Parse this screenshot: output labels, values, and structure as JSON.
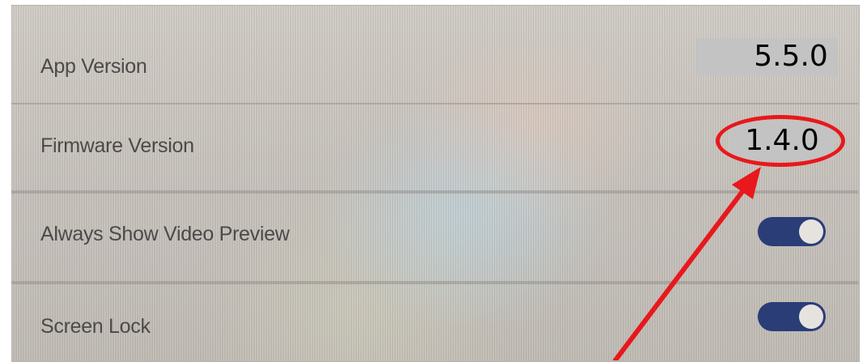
{
  "settings": {
    "app_version": {
      "label": "App Version",
      "value": "5.5.0"
    },
    "firmware_version": {
      "label": "Firmware Version",
      "value": "1.4.0"
    },
    "always_show_video_preview": {
      "label": "Always Show Video Preview",
      "enabled": true
    },
    "screen_lock": {
      "label": "Screen Lock",
      "enabled": true
    }
  },
  "annotation": {
    "highlight_color": "#e8181c",
    "highlighted_item": "firmware_version"
  },
  "colors": {
    "toggle_on": "#2a3d77",
    "value_box": "#c3c3c3"
  }
}
